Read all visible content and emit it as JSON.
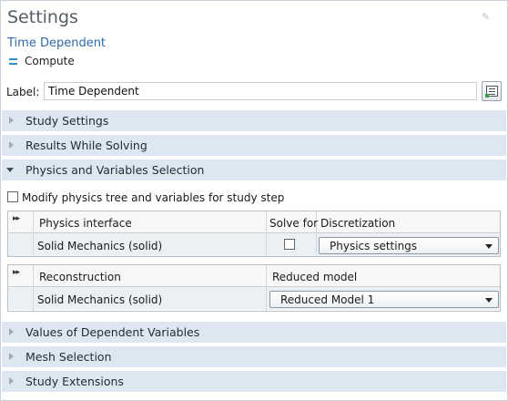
{
  "header": {
    "title": "Settings",
    "subtitle": "Time Dependent",
    "compute_label": "Compute"
  },
  "label_field": {
    "label": "Label:",
    "value": "Time Dependent"
  },
  "sections": {
    "study_settings": "Study Settings",
    "results_while_solving": "Results While Solving",
    "physics_variables": "Physics and Variables Selection",
    "values_dependent": "Values of Dependent Variables",
    "mesh_selection": "Mesh Selection",
    "study_extensions": "Study Extensions"
  },
  "modify": {
    "label": "Modify physics tree and variables for study step",
    "checked": false
  },
  "physics_table": {
    "columns": [
      "Physics interface",
      "Solve for",
      "Discretization"
    ],
    "rows": [
      {
        "interface": "Solid Mechanics (solid)",
        "solve_for": false,
        "discretization": "Physics settings"
      }
    ]
  },
  "reconstruction_table": {
    "columns": [
      "Reconstruction",
      "Reduced model"
    ],
    "rows": [
      {
        "reconstruction": "Solid Mechanics (solid)",
        "reduced_model": "Reduced Model 1"
      }
    ]
  },
  "colors": {
    "section_bg": "#dce7f2",
    "subtitle": "#2d6aa8",
    "title": "#555d66"
  }
}
